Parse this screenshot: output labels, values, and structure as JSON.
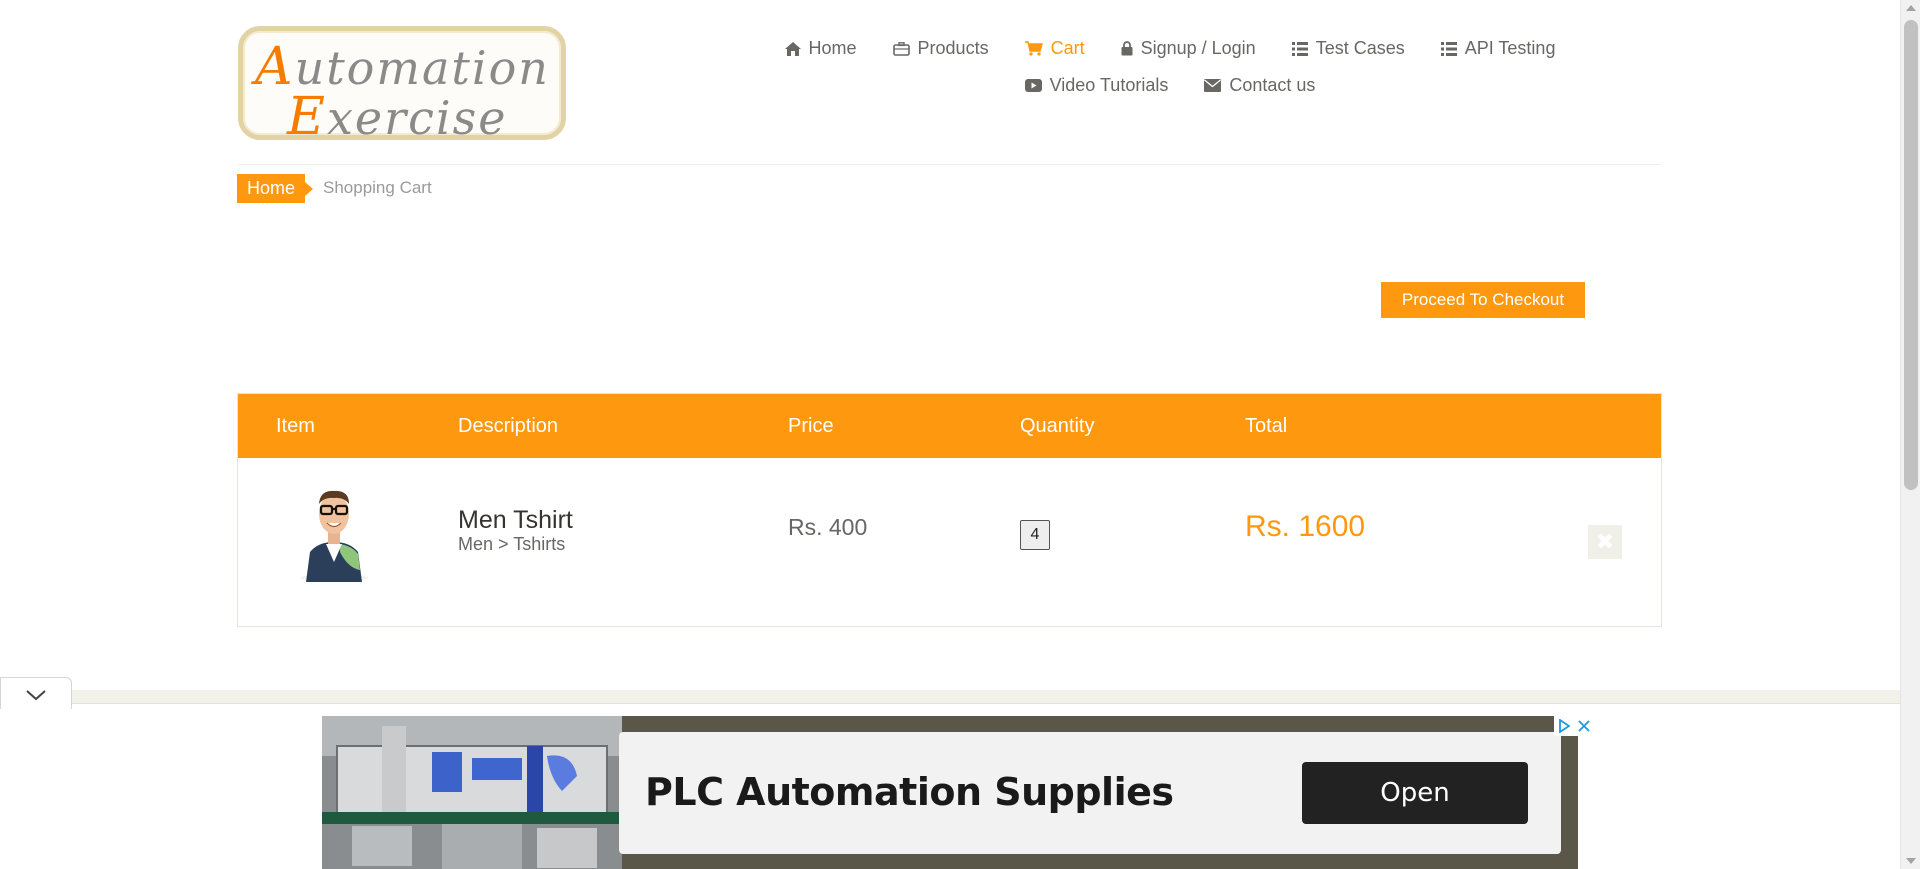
{
  "logo": {
    "line1_cap": "A",
    "line1_rest": "utomation",
    "line2_cap": "E",
    "line2_rest": "xercise"
  },
  "nav": {
    "row1": [
      {
        "label": "Home",
        "icon": "home-icon"
      },
      {
        "label": "Products",
        "icon": "briefcase-icon"
      },
      {
        "label": "Cart",
        "icon": "cart-icon",
        "active": true
      },
      {
        "label": "Signup / Login",
        "icon": "lock-icon"
      },
      {
        "label": "Test Cases",
        "icon": "list-icon"
      },
      {
        "label": "API Testing",
        "icon": "list-icon"
      }
    ],
    "row2": [
      {
        "label": "Video Tutorials",
        "icon": "youtube-play-icon"
      },
      {
        "label": "Contact us",
        "icon": "envelope-icon"
      }
    ]
  },
  "breadcrumb": {
    "home": "Home",
    "current": "Shopping Cart"
  },
  "checkout": {
    "label": "Proceed To Checkout"
  },
  "cart": {
    "headers": {
      "item": "Item",
      "description": "Description",
      "price": "Price",
      "quantity": "Quantity",
      "total": "Total"
    },
    "items": [
      {
        "name": "Men Tshirt",
        "category": "Men > Tshirts",
        "price": "Rs. 400",
        "quantity": "4",
        "total": "Rs. 1600"
      }
    ]
  },
  "ad": {
    "title": "PLC Automation Supplies",
    "button": "Open"
  },
  "colors": {
    "accent": "#fe980f",
    "text": "#696763",
    "dark": "#363432"
  }
}
